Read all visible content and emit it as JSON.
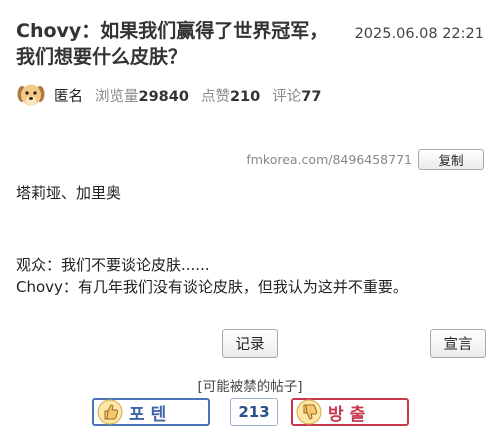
{
  "post": {
    "title": "Chovy：如果我们赢得了世界冠军，我们想要什么皮肤？",
    "datetime": "2025.06.08 22:21",
    "author": "匿名",
    "avatar_icon": "puppy-avatar-icon",
    "views_label": "浏览量",
    "views": "29840",
    "likes_label": "点赞",
    "likes": "210",
    "comments_label": "评论",
    "comments": "77",
    "url": "fmkorea.com/8496458771",
    "copy_label": "复制"
  },
  "body": {
    "line1": "塔莉垭、加里奥",
    "line2": "观众：我们不要谈论皮肤......",
    "line3": "Chovy：有几年我们没有谈论皮肤，但我认为这并不重要。"
  },
  "actions": {
    "record_label": "记录",
    "declare_label": "宣言",
    "ban_note": "[可能被禁的帖子]"
  },
  "vote": {
    "up_label": "포텐",
    "count": "213",
    "down_label": "방출",
    "up_icon": "thumbs-up-icon",
    "down_icon": "thumbs-down-icon",
    "up_color": "#4a74b9",
    "down_color": "#c8374d"
  }
}
